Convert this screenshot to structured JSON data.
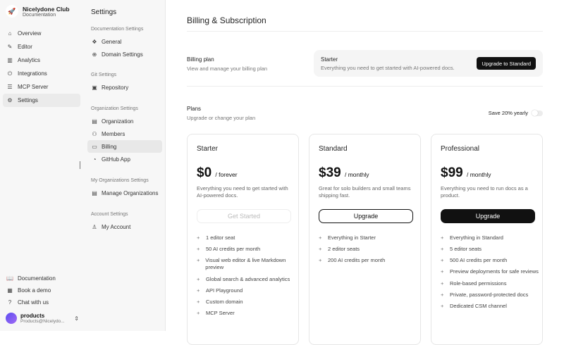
{
  "brand": {
    "name": "Nicelydone Club",
    "sub": "Documentation"
  },
  "nav": [
    {
      "label": "Overview",
      "icon": "⌂"
    },
    {
      "label": "Editor",
      "icon": "✎"
    },
    {
      "label": "Analytics",
      "icon": "▥"
    },
    {
      "label": "Integrations",
      "icon": "⏻"
    },
    {
      "label": "MCP Server",
      "icon": "☰"
    },
    {
      "label": "Settings",
      "icon": "⚙"
    }
  ],
  "footer": [
    {
      "label": "Documentation",
      "icon": "📖"
    },
    {
      "label": "Book a demo",
      "icon": "▦"
    },
    {
      "label": "Chat with us",
      "icon": "?"
    }
  ],
  "user": {
    "name": "products",
    "email": "Products@Nicelydo..."
  },
  "settings": {
    "title": "Settings",
    "sections": [
      {
        "label": "Documentation Settings",
        "items": [
          {
            "label": "General",
            "icon": "❖"
          },
          {
            "label": "Domain Settings",
            "icon": "⊕"
          }
        ]
      },
      {
        "label": "Git Settings",
        "items": [
          {
            "label": "Repository",
            "icon": "▣"
          }
        ]
      },
      {
        "label": "Organization Settings",
        "items": [
          {
            "label": "Organization",
            "icon": "▤"
          },
          {
            "label": "Members",
            "icon": "⚇"
          },
          {
            "label": "Billing",
            "icon": "▭"
          },
          {
            "label": "GitHub App",
            "icon": "◔"
          }
        ]
      },
      {
        "label": "My Organizations Settings",
        "items": [
          {
            "label": "Manage Organizations",
            "icon": "▤"
          }
        ]
      },
      {
        "label": "Account Settings",
        "items": [
          {
            "label": "My Account",
            "icon": "♙"
          }
        ]
      }
    ]
  },
  "main": {
    "title": "Billing & Subscription",
    "billing_label": "Billing plan",
    "billing_sub": "View and manage your billing plan",
    "current_plan": "Starter",
    "current_desc": "Everything you need to get started with AI-powered docs.",
    "upgrade_label": "Upgrade to Standard",
    "plans_label": "Plans",
    "plans_sub": "Upgrade or change your plan",
    "save_label": "Save 20% yearly",
    "save_yearly": false
  },
  "plans": [
    {
      "name": "Starter",
      "price": "$0",
      "period": "/ forever",
      "desc": "Everything you need to get started with AI-powered docs.",
      "button": "Get Started",
      "features": [
        "1 editor seat",
        "50 AI credits per month",
        "Visual web editor & live Markdown preview",
        "Global search & advanced analytics",
        "API Playground",
        "Custom domain",
        "MCP Server"
      ]
    },
    {
      "name": "Standard",
      "price": "$39",
      "period": "/ monthly",
      "desc": "Great for solo builders and small teams shipping fast.",
      "button": "Upgrade",
      "features": [
        "Everything in Starter",
        "2 editor seats",
        "200 AI credits per month"
      ]
    },
    {
      "name": "Professional",
      "price": "$99",
      "period": "/ monthly",
      "desc": "Everything you need to run docs as a product.",
      "button": "Upgrade",
      "features": [
        "Everything in Standard",
        "5 editor seats",
        "500 AI credits per month",
        "Preview deployments for safe reviews",
        "Role-based permissions",
        "Private, password-protected docs",
        "Dedicated CSM channel"
      ]
    }
  ]
}
